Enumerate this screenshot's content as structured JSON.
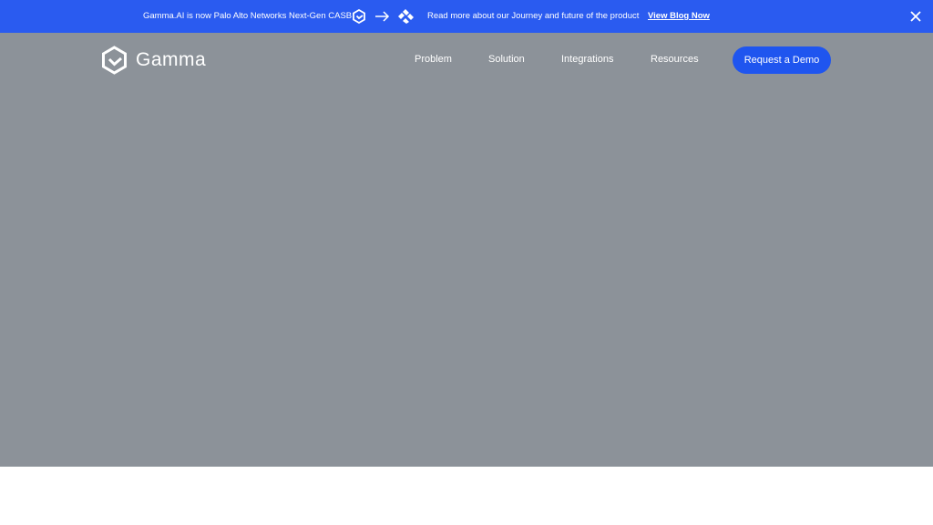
{
  "announcement": {
    "text": "Gamma.AI is now Palo Alto Networks Next-Gen CASB",
    "icons": [
      "gamma-logo-icon",
      "arrow-right-icon",
      "palo-alto-logo-icon"
    ],
    "journey_text": "Read more about our Journey and future of the product",
    "link_label": "View Blog Now",
    "close_icon": "close-icon",
    "background": "#2a5bf0"
  },
  "header": {
    "logo_text": "Gamma",
    "nav": [
      "Problem",
      "Solution",
      "Integrations",
      "Resources"
    ],
    "cta_label": "Request a Demo",
    "cta_color": "#1f55ef"
  },
  "hero": {
    "background": "#8c9299"
  }
}
